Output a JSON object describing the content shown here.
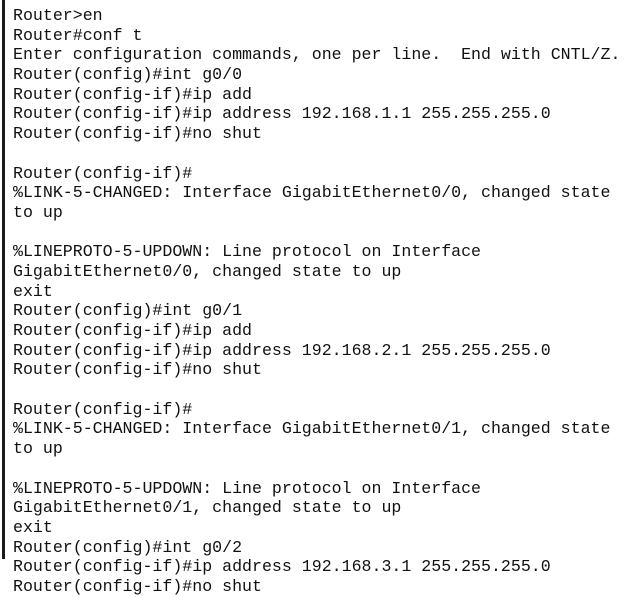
{
  "terminal": {
    "kind": "cisco-ios-cli-console",
    "background_color": "#ffffff",
    "text_color": "#111111",
    "left_rule_color": "#1a1a1a",
    "lines": [
      "Router>en",
      "Router#conf t",
      "Enter configuration commands, one per line.  End with CNTL/Z.",
      "Router(config)#int g0/0",
      "Router(config-if)#ip add",
      "Router(config-if)#ip address 192.168.1.1 255.255.255.0",
      "Router(config-if)#no shut",
      "",
      "Router(config-if)#",
      "%LINK-5-CHANGED: Interface GigabitEthernet0/0, changed state",
      "to up",
      "",
      "%LINEPROTO-5-UPDOWN: Line protocol on Interface",
      "GigabitEthernet0/0, changed state to up",
      "exit",
      "Router(config)#int g0/1",
      "Router(config-if)#ip add",
      "Router(config-if)#ip address 192.168.2.1 255.255.255.0",
      "Router(config-if)#no shut",
      "",
      "Router(config-if)#",
      "%LINK-5-CHANGED: Interface GigabitEthernet0/1, changed state",
      "to up",
      "",
      "%LINEPROTO-5-UPDOWN: Line protocol on Interface",
      "GigabitEthernet0/1, changed state to up",
      "exit",
      "Router(config)#int g0/2",
      "Router(config-if)#ip address 192.168.3.1 255.255.255.0",
      "Router(config-if)#no shut"
    ]
  }
}
